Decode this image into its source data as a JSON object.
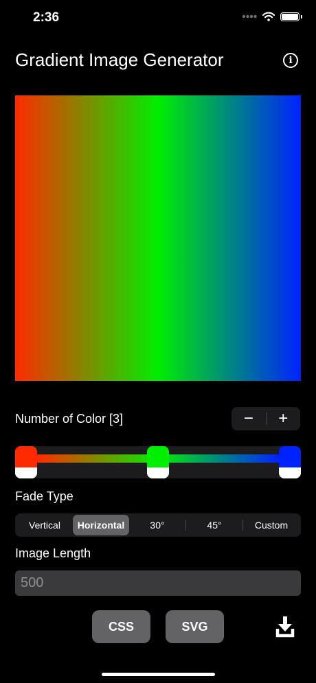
{
  "status_bar": {
    "time": "2:36"
  },
  "header": {
    "title": "Gradient Image Generator",
    "info_icon": "info-icon"
  },
  "gradient": {
    "direction": "Horizontal",
    "colors": [
      "#ff2a00",
      "#00ee00",
      "#0022ff"
    ],
    "stops": [
      0,
      0.5,
      1
    ]
  },
  "number_of_color": {
    "label": "Number of Color [3]",
    "minus": "−",
    "plus": "+"
  },
  "fade_type": {
    "label": "Fade Type",
    "options": [
      "Vertical",
      "Horizontal",
      "30°",
      "45°",
      "Custom"
    ],
    "selected": "Horizontal"
  },
  "image_length": {
    "label": "Image Length",
    "placeholder": "500"
  },
  "actions": {
    "css": "CSS",
    "svg": "SVG",
    "download_icon": "download-icon"
  }
}
